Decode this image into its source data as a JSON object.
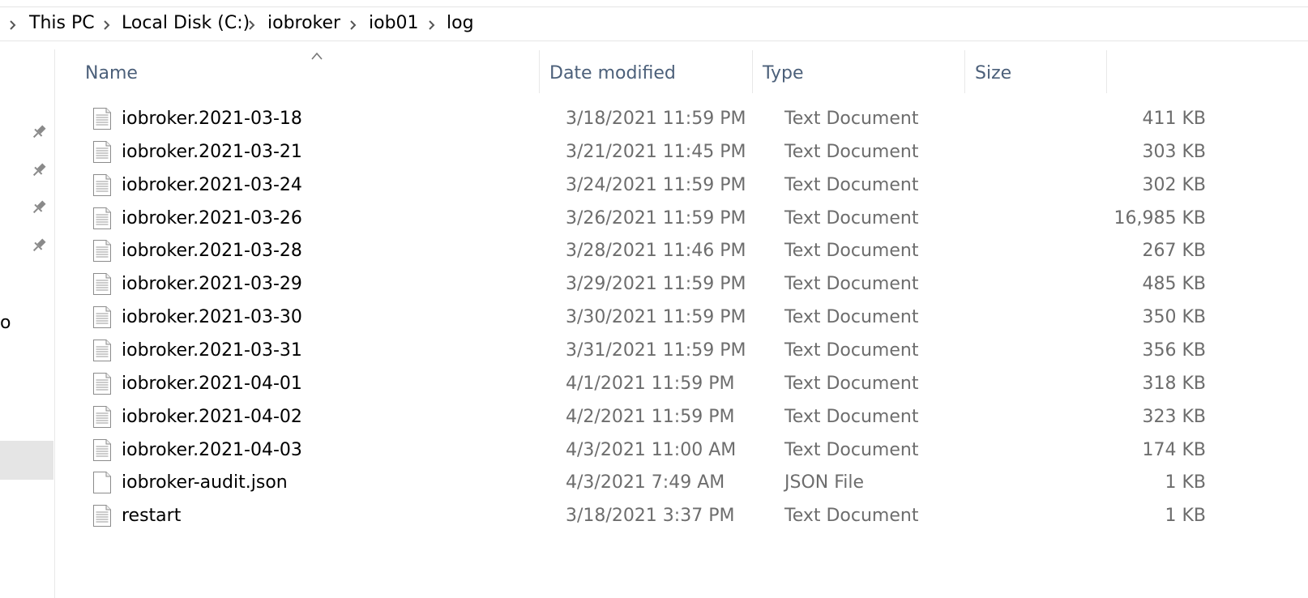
{
  "breadcrumb": {
    "items": [
      "This PC",
      "Local Disk (C:)",
      "iobroker",
      "iob01",
      "log"
    ]
  },
  "nav": {
    "fragment_text": "o",
    "pin_icon": "pin-icon"
  },
  "columns": {
    "name": "Name",
    "date": "Date modified",
    "type": "Type",
    "size": "Size"
  },
  "files": [
    {
      "name": "iobroker.2021-03-18",
      "date": "3/18/2021 11:59 PM",
      "type": "Text Document",
      "size": "411 KB",
      "icon": "text-file-icon"
    },
    {
      "name": "iobroker.2021-03-21",
      "date": "3/21/2021 11:45 PM",
      "type": "Text Document",
      "size": "303 KB",
      "icon": "text-file-icon"
    },
    {
      "name": "iobroker.2021-03-24",
      "date": "3/24/2021 11:59 PM",
      "type": "Text Document",
      "size": "302 KB",
      "icon": "text-file-icon"
    },
    {
      "name": "iobroker.2021-03-26",
      "date": "3/26/2021 11:59 PM",
      "type": "Text Document",
      "size": "16,985 KB",
      "icon": "text-file-icon"
    },
    {
      "name": "iobroker.2021-03-28",
      "date": "3/28/2021 11:46 PM",
      "type": "Text Document",
      "size": "267 KB",
      "icon": "text-file-icon"
    },
    {
      "name": "iobroker.2021-03-29",
      "date": "3/29/2021 11:59 PM",
      "type": "Text Document",
      "size": "485 KB",
      "icon": "text-file-icon"
    },
    {
      "name": "iobroker.2021-03-30",
      "date": "3/30/2021 11:59 PM",
      "type": "Text Document",
      "size": "350 KB",
      "icon": "text-file-icon"
    },
    {
      "name": "iobroker.2021-03-31",
      "date": "3/31/2021 11:59 PM",
      "type": "Text Document",
      "size": "356 KB",
      "icon": "text-file-icon"
    },
    {
      "name": "iobroker.2021-04-01",
      "date": "4/1/2021 11:59 PM",
      "type": "Text Document",
      "size": "318 KB",
      "icon": "text-file-icon"
    },
    {
      "name": "iobroker.2021-04-02",
      "date": "4/2/2021 11:59 PM",
      "type": "Text Document",
      "size": "323 KB",
      "icon": "text-file-icon"
    },
    {
      "name": "iobroker.2021-04-03",
      "date": "4/3/2021 11:00 AM",
      "type": "Text Document",
      "size": "174 KB",
      "icon": "text-file-icon"
    },
    {
      "name": "iobroker-audit.json",
      "date": "4/3/2021 7:49 AM",
      "type": "JSON File",
      "size": "1 KB",
      "icon": "json-file-icon"
    },
    {
      "name": "restart",
      "date": "3/18/2021 3:37 PM",
      "type": "Text Document",
      "size": "1 KB",
      "icon": "text-file-icon"
    }
  ]
}
